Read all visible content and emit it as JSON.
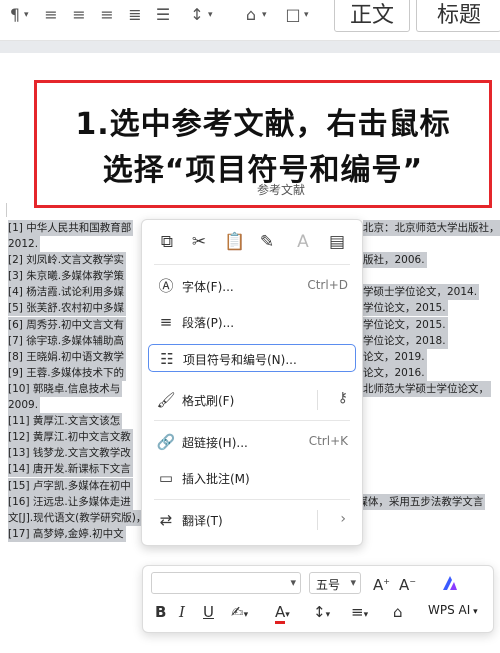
{
  "toolbar": {
    "style_box_1": "正文",
    "style_box_2": "标题"
  },
  "banner": {
    "line1": "1.选中参考文献，右击鼠标",
    "line2": "选择“项目符号和编号”",
    "subtitle": "参考文献"
  },
  "references": [
    {
      "left": "[1]  中华人民共和国教育部",
      "right": "北京：北京师范大学出版社，"
    },
    {
      "left": "2012.",
      "right": ""
    },
    {
      "left": "[2]  刘凤岭.文言文教学实",
      "right": "版社，2006."
    },
    {
      "left": "[3]  朱京曦.多媒体教学策",
      "right": ""
    },
    {
      "left": "[4]  杨洁霞.试论利用多媒",
      "right": "学硕士学位论文，2014."
    },
    {
      "left": "[5]  张芙舒.农村初中多媒",
      "right": "学位论文，2015."
    },
    {
      "left": "[6]  周秀芬.初中文言文有",
      "right": "学位论文，2015."
    },
    {
      "left": "[7]  徐宇琼.多媒体辅助高",
      "right": "学位论文，2018."
    },
    {
      "left": "[8]  王晓娟.初中语文教学",
      "right": "论文，2019."
    },
    {
      "left": "[9]  王蓉.多媒体技术下的",
      "right": "论文，2016."
    },
    {
      "left": "[10]  郭晓卓.信息技术与",
      "right": "北师范大学硕士学位论文，"
    },
    {
      "left": "2009.",
      "right": ""
    },
    {
      "left": "[11]  黄厚江.文言文该怎",
      "right": ""
    },
    {
      "left": "[12]  黄厚江.初中文言文教",
      "right": ""
    },
    {
      "left": "[13]  钱梦龙.文言文教学改",
      "right": ""
    },
    {
      "left": "[14]  唐开发.新课标下文言",
      "right": ""
    },
    {
      "left": "[15]  卢字凯.多媒体在初中",
      "right": ""
    },
    {
      "left": "[16]  汪远忠.让多媒体走进",
      "right": "以《桃花源记》为例.运用多媒体，采用五步法教学文言"
    },
    {
      "left": "文[J].现代语文(教学研究版)，2009.",
      "right": ""
    },
    {
      "left": "[17]  高梦婷,金婷.初中文",
      "right": ""
    }
  ],
  "context_menu": {
    "items": [
      {
        "label": "字体(F)...",
        "shortcut": "Ctrl+D"
      },
      {
        "label": "段落(P)...",
        "shortcut": ""
      },
      {
        "label": "项目符号和编号(N)...",
        "shortcut": ""
      },
      {
        "label": "格式刷(F)",
        "shortcut": ""
      },
      {
        "label": "超链接(H)...",
        "shortcut": "Ctrl+K"
      },
      {
        "label": "插入批注(M)",
        "shortcut": ""
      },
      {
        "label": "翻译(T)",
        "shortcut": ""
      }
    ]
  },
  "format_bar": {
    "font_name": "",
    "font_size": "五号",
    "wps_ai_label": "WPS AI"
  },
  "colors": {
    "banner_border": "#e5262b",
    "selection_highlight": "#c9ccd1",
    "menu_highlight_border": "#5b8def",
    "font_color_red": "#e02020"
  }
}
